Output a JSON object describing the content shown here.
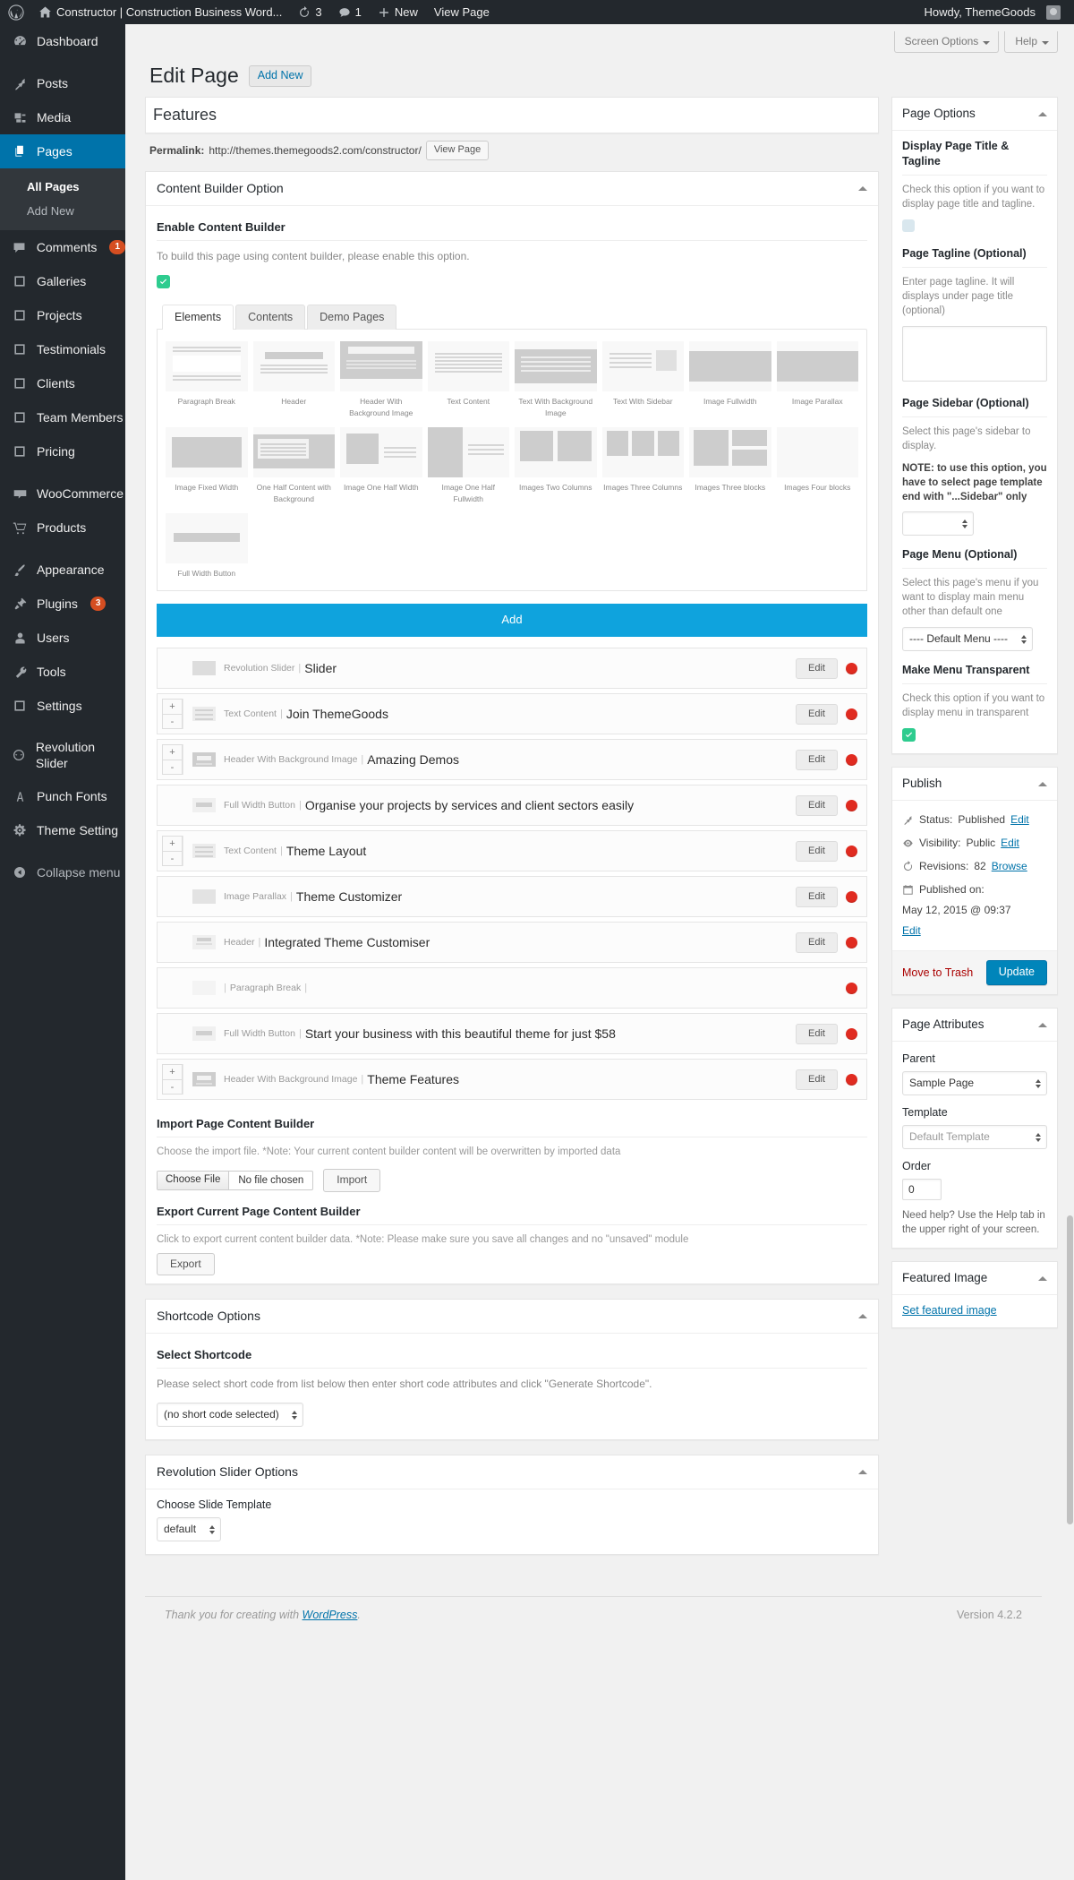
{
  "adminbar": {
    "site_title": "Constructor | Construction Business Word...",
    "updates_count": "3",
    "comments_count": "1",
    "new_label": "New",
    "view_page_label": "View Page",
    "howdy": "Howdy, ThemeGoods"
  },
  "sidebar": {
    "items": [
      {
        "label": "Dashboard",
        "icon": "dashboard-icon",
        "current": false
      },
      {
        "label": "Posts",
        "icon": "pin-icon",
        "current": false
      },
      {
        "label": "Media",
        "icon": "media-icon",
        "current": false
      },
      {
        "label": "Pages",
        "icon": "pages-icon",
        "current": true
      },
      {
        "label": "Comments",
        "icon": "comment-icon",
        "current": false,
        "badge": "1"
      },
      {
        "label": "Galleries",
        "icon": "post-type-icon",
        "current": false
      },
      {
        "label": "Projects",
        "icon": "post-type-icon",
        "current": false
      },
      {
        "label": "Testimonials",
        "icon": "post-type-icon",
        "current": false
      },
      {
        "label": "Clients",
        "icon": "post-type-icon",
        "current": false
      },
      {
        "label": "Team Members",
        "icon": "post-type-icon",
        "current": false
      },
      {
        "label": "Pricing",
        "icon": "post-type-icon",
        "current": false
      },
      {
        "label": "WooCommerce",
        "icon": "woocommerce-icon",
        "current": false
      },
      {
        "label": "Products",
        "icon": "cart-icon",
        "current": false
      },
      {
        "label": "Appearance",
        "icon": "brush-icon",
        "current": false
      },
      {
        "label": "Plugins",
        "icon": "plugin-icon",
        "current": false,
        "badge": "3"
      },
      {
        "label": "Users",
        "icon": "user-icon",
        "current": false
      },
      {
        "label": "Tools",
        "icon": "wrench-icon",
        "current": false
      },
      {
        "label": "Settings",
        "icon": "settings-icon",
        "current": false
      },
      {
        "label": "Revolution Slider",
        "icon": "revslider-icon",
        "current": false
      },
      {
        "label": "Punch Fonts",
        "icon": "font-icon",
        "current": false
      },
      {
        "label": "Theme Setting",
        "icon": "gear-icon",
        "current": false
      },
      {
        "label": "Collapse menu",
        "icon": "collapse-icon",
        "current": false
      }
    ],
    "submenu": [
      {
        "label": "All Pages",
        "current": true
      },
      {
        "label": "Add New",
        "current": false
      }
    ]
  },
  "screen_meta": {
    "screen_options": "Screen Options",
    "help": "Help"
  },
  "header": {
    "title": "Edit Page",
    "add_new": "Add New"
  },
  "post": {
    "title_value": "Features",
    "permalink_label": "Permalink:",
    "permalink_url": "http://themes.themegoods2.com/constructor/",
    "view_page_btn": "View Page"
  },
  "content_builder": {
    "box_title": "Content Builder Option",
    "enable_label": "Enable Content Builder",
    "enable_desc": "To build this page using content builder, please enable this option.",
    "enabled": true,
    "tabs": [
      {
        "label": "Elements",
        "active": true
      },
      {
        "label": "Contents",
        "active": false
      },
      {
        "label": "Demo Pages",
        "active": false
      }
    ],
    "elements": [
      {
        "label": "Paragraph Break",
        "thumb": "paragraph-break"
      },
      {
        "label": "Header",
        "thumb": "header"
      },
      {
        "label": "Header With Background Image",
        "thumb": "header-bg"
      },
      {
        "label": "Text Content",
        "thumb": "text-content"
      },
      {
        "label": "Text With Background Image",
        "thumb": "text-bg"
      },
      {
        "label": "Text With Sidebar",
        "thumb": "text-sidebar"
      },
      {
        "label": "Image Fullwidth",
        "thumb": "image-fullwidth"
      },
      {
        "label": "Image Parallax",
        "thumb": "image-parallax"
      },
      {
        "label": "Image Fixed Width",
        "thumb": "image-fixed"
      },
      {
        "label": "One Half Content with Background",
        "thumb": "half-content-bg"
      },
      {
        "label": "Image One Half Width",
        "thumb": "image-half-width"
      },
      {
        "label": "Image One Half Fullwidth",
        "thumb": "image-half-full"
      },
      {
        "label": "Images Two Columns",
        "thumb": "images-two"
      },
      {
        "label": "Images Three Columns",
        "thumb": "images-three"
      },
      {
        "label": "Images Three blocks",
        "thumb": "images-three-blocks"
      },
      {
        "label": "Images Four blocks",
        "thumb": "images-four-blocks"
      },
      {
        "label": "Full Width Button",
        "thumb": "full-width-button"
      }
    ],
    "add_button": "Add",
    "modules": [
      {
        "type": "Revolution Slider",
        "title": "Slider",
        "edit": "Edit",
        "has_move": false,
        "icon": "slider-icon"
      },
      {
        "type": "Text Content",
        "title": "Join ThemeGoods",
        "edit": "Edit",
        "has_move": true,
        "icon": "text-icon"
      },
      {
        "type": "Header With Background Image",
        "title": "Amazing Demos",
        "edit": "Edit",
        "has_move": true,
        "icon": "header-bg-icon"
      },
      {
        "type": "Full Width Button",
        "title": "Organise your projects by services and client sectors easily",
        "edit": "Edit",
        "has_move": false,
        "icon": "button-icon"
      },
      {
        "type": "Text Content",
        "title": "Theme Layout",
        "edit": "Edit",
        "has_move": true,
        "icon": "text-icon"
      },
      {
        "type": "Image Parallax",
        "title": "Theme Customizer",
        "edit": "Edit",
        "has_move": false,
        "icon": "parallax-icon"
      },
      {
        "type": "Header",
        "title": "Integrated Theme Customiser",
        "edit": "Edit",
        "has_move": false,
        "icon": "header-icon"
      },
      {
        "type": "Paragraph Break",
        "title": "",
        "edit": "",
        "has_move": false,
        "icon": "break-icon"
      },
      {
        "type": "Full Width Button",
        "title": "Start your business with this beautiful theme for just $58",
        "edit": "Edit",
        "has_move": false,
        "icon": "button-icon"
      },
      {
        "type": "Header With Background Image",
        "title": "Theme Features",
        "edit": "Edit",
        "has_move": true,
        "icon": "header-bg-icon"
      }
    ],
    "move_up": "+",
    "move_down": "-",
    "import_title": "Import Page Content Builder",
    "import_desc": "Choose the import file. *Note: Your current content builder content will be overwritten by imported data",
    "choose_file": "Choose File",
    "no_file": "No file chosen",
    "import_btn": "Import",
    "export_title": "Export Current Page Content Builder",
    "export_desc": "Click to export current content builder data. *Note: Please make sure you save all changes and no \"unsaved\" module",
    "export_btn": "Export"
  },
  "shortcode": {
    "box_title": "Shortcode Options",
    "select_label": "Select Shortcode",
    "desc": "Please select short code from list below then enter short code attributes and click \"Generate Shortcode\".",
    "selected": "(no short code selected)"
  },
  "revslider": {
    "box_title": "Revolution Slider Options",
    "choose_label": "Choose Slide Template",
    "selected": "default"
  },
  "page_options": {
    "box_title": "Page Options",
    "display_title_label": "Display Page Title & Tagline",
    "display_title_desc": "Check this option if you want to display page title and tagline.",
    "tagline_label": "Page Tagline (Optional)",
    "tagline_desc": "Enter page tagline. It will displays under page title (optional)",
    "tagline_value": "",
    "sidebar_label": "Page Sidebar (Optional)",
    "sidebar_desc": "Select this page's sidebar to display.",
    "sidebar_note": "NOTE: to use this option, you have to select page template end with \"...Sidebar\" only",
    "sidebar_selected": "",
    "menu_label": "Page Menu (Optional)",
    "menu_desc": "Select this page's menu if you want to display main menu other than default one",
    "menu_selected": "---- Default Menu ----",
    "transparent_label": "Make Menu Transparent",
    "transparent_desc": "Check this option if you want to display menu in transparent",
    "transparent_checked": true
  },
  "publish": {
    "box_title": "Publish",
    "status_label": "Status:",
    "status_value": "Published",
    "status_edit": "Edit",
    "visibility_label": "Visibility:",
    "visibility_value": "Public",
    "visibility_edit": "Edit",
    "revisions_label": "Revisions:",
    "revisions_value": "82",
    "revisions_browse": "Browse",
    "published_label": "Published on:",
    "published_value": "May 12, 2015 @ 09:37",
    "published_edit": "Edit",
    "trash": "Move to Trash",
    "update": "Update"
  },
  "page_attributes": {
    "box_title": "Page Attributes",
    "parent_label": "Parent",
    "parent_selected": "Sample Page",
    "template_label": "Template",
    "template_selected": "Default Template",
    "order_label": "Order",
    "order_value": "0",
    "help": "Need help? Use the Help tab in the upper right of your screen."
  },
  "featured_image": {
    "box_title": "Featured Image",
    "set_link": "Set featured image"
  },
  "footer": {
    "thanks_prefix": "Thank you for creating with ",
    "wp_link": "WordPress",
    "thanks_suffix": ".",
    "version": "Version 4.2.2"
  },
  "colors": {
    "accent": "#0073aa",
    "add_bar": "#0fa3dd",
    "check_green": "#2ecc8f",
    "delete_red": "#e02b20",
    "badge_orange": "#d54e21"
  }
}
